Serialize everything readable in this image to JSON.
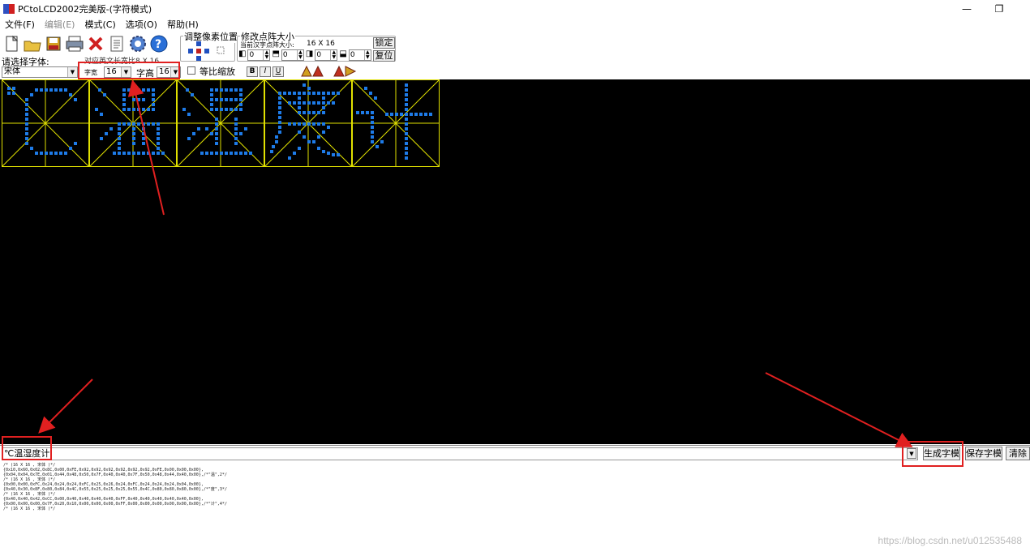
{
  "window": {
    "title": "PCtoLCD2002完美版-(字符模式)",
    "minimize": "—",
    "restore": "❐"
  },
  "menu": [
    "文件(F)",
    "编辑(E)",
    "模式(C)",
    "选项(O)",
    "帮助(H)"
  ],
  "toolbar_icons": [
    "new-icon",
    "open-icon",
    "save-icon",
    "print-icon",
    "delete-icon",
    "document-icon",
    "gear-icon",
    "help-icon"
  ],
  "pixel_adjust": {
    "legend": "调整像素位置"
  },
  "resize": {
    "legend": "修改点阵大小",
    "current_label": "当前汉字点阵大小:",
    "current_size": "16 X 16",
    "lock": "锁定",
    "reset": "复位",
    "spins": [
      "0",
      "0",
      "0",
      "0"
    ]
  },
  "font": {
    "label": "请选择字体:",
    "value": "宋体",
    "ascii_label": "对应英文长宽比8 X 16",
    "width_label": "字宽",
    "width_value": "16",
    "height_label": "字高",
    "height_value": "16",
    "proportional_label": "等比缩放",
    "bold": "B",
    "italic": "I",
    "underline": "U"
  },
  "glyph_colors": {
    "dot": "#1e7be8",
    "grid": "#e0e000",
    "bg": "#000000"
  },
  "glyphs": [
    "℃",
    "温",
    "湿",
    "度",
    "计"
  ],
  "input": {
    "value": "℃温湿度计"
  },
  "buttons": {
    "generate": "生成字模",
    "save": "保存字模",
    "clear": "清除"
  },
  "output_lines": [
    "/* (16 X 16 , 宋体 )*/",
    "",
    "{0x10,0x60,0x02,0x8C,0x00,0xFE,0x92,0x92,0x92,0x92,0x92,0x92,0xFE,0x00,0x00,0x00},",
    "{0x04,0x04,0x7E,0x01,0x44,0x48,0x50,0x7F,0x40,0x40,0x7F,0x50,0x48,0x44,0x40,0x00},/*\"温\",2*/",
    "/* (16 X 16 , 宋体 )*/",
    "",
    "{0x00,0x00,0xFC,0x24,0x24,0x24,0xFC,0x25,0x26,0x24,0xFC,0x24,0x24,0x24,0x04,0x00},",
    "{0x40,0x30,0x8F,0x80,0x84,0x4C,0x55,0x25,0x25,0x25,0x55,0x4C,0x80,0x80,0x80,0x00},/*\"度\",3*/",
    "/* (16 X 16 , 宋体 )*/",
    "",
    "{0x40,0x40,0x42,0xCC,0x00,0x40,0x40,0x40,0x40,0xFF,0x40,0x40,0x40,0x40,0x40,0x00},",
    "{0x00,0x00,0x00,0x7F,0x20,0x10,0x00,0x00,0x00,0xFF,0x00,0x00,0x00,0x00,0x00,0x00},/*\"计\",4*/",
    "/* (16 X 16 , 宋体 )*/"
  ],
  "watermark": "https://blog.csdn.net/u012535488"
}
